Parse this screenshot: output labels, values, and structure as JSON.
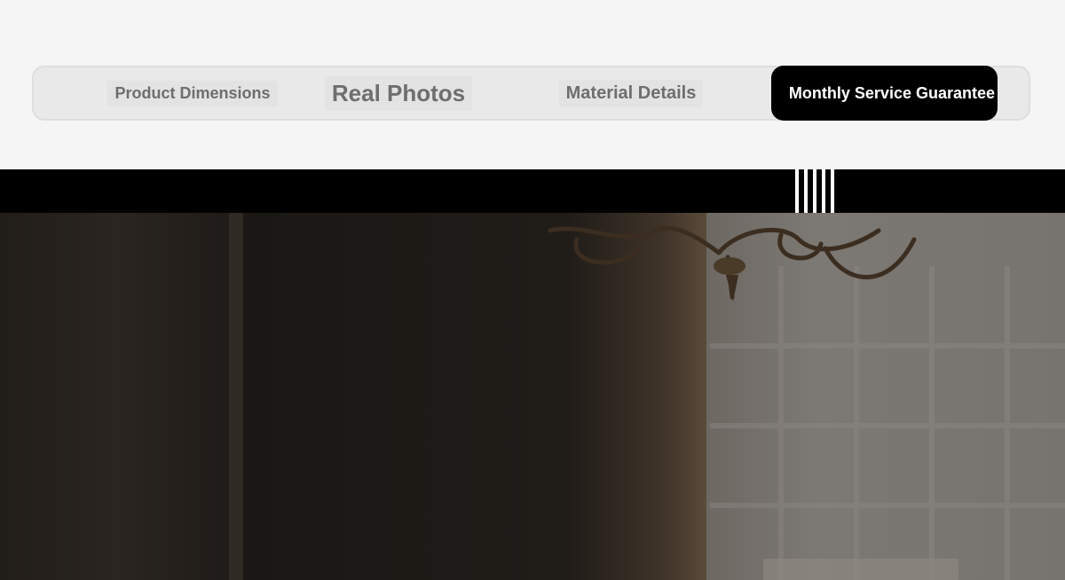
{
  "tabs": [
    {
      "label": "Product Dimensions",
      "active": false
    },
    {
      "label": "Real Photos",
      "active": false
    },
    {
      "label": "Material Details",
      "active": false
    },
    {
      "label": "Monthly Service Guarantee",
      "active": true
    }
  ],
  "colors": {
    "page_bg": "#f5f5f5",
    "tab_bar_bg": "#e9e9e9",
    "tab_text": "#6e6e6e",
    "active_tab_bg": "#000000",
    "active_tab_text": "#ffffff",
    "band": "#000000"
  },
  "decoration": {
    "stripe_count": 5
  },
  "photo": {
    "subject": "dark interior with curtains and chandelier"
  }
}
